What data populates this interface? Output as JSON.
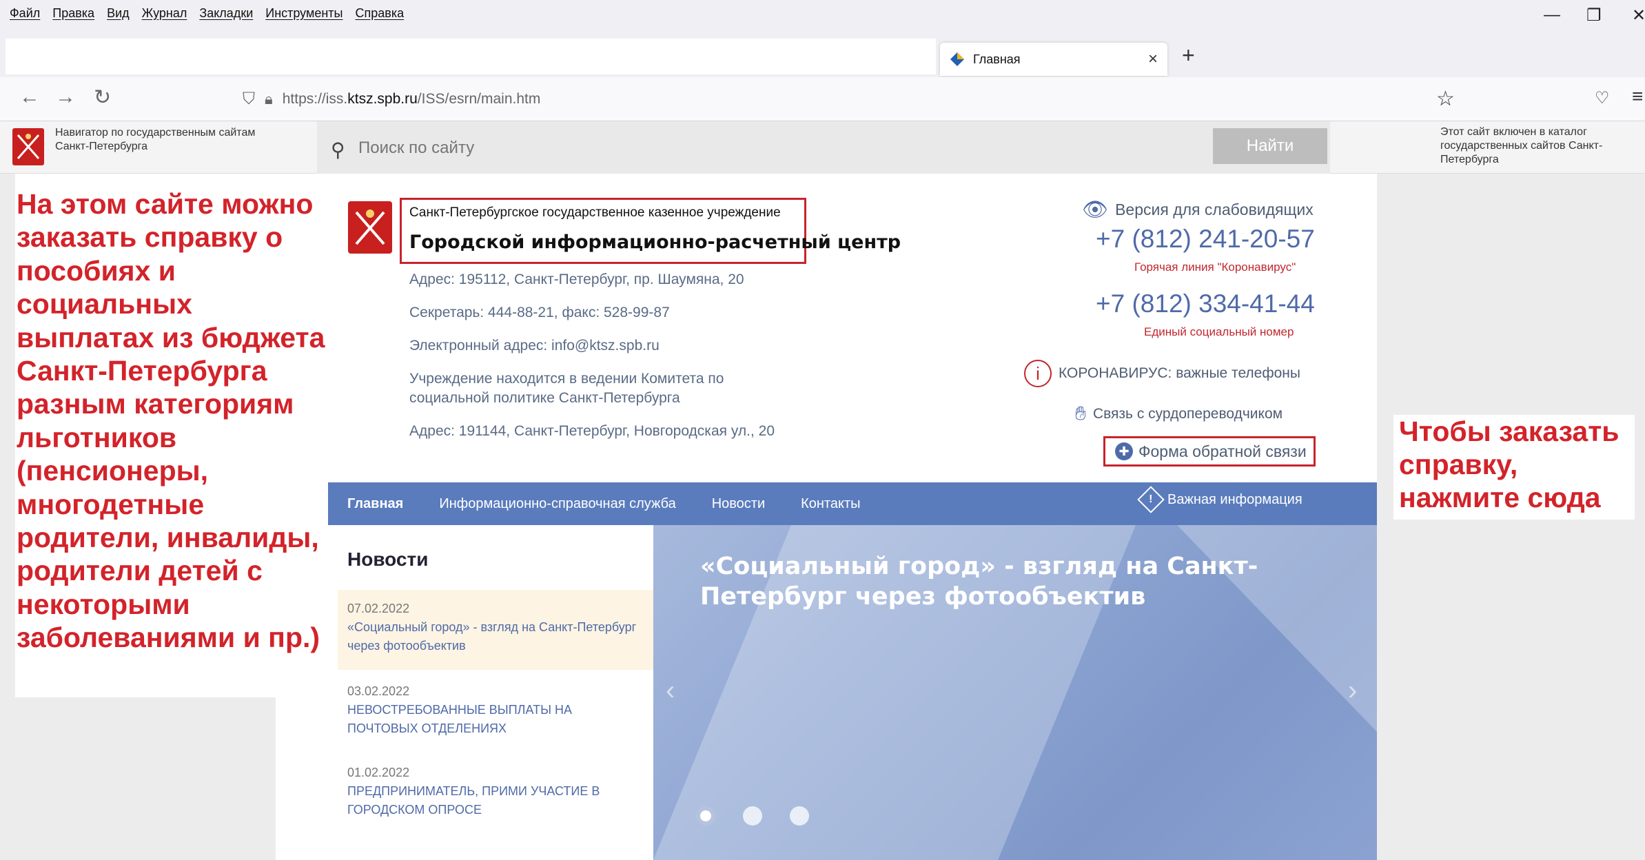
{
  "browser": {
    "menu": [
      "Файл",
      "Правка",
      "Вид",
      "Журнал",
      "Закладки",
      "Инструменты",
      "Справка"
    ],
    "tab_title": "Главная",
    "url_prefix": "https://iss.",
    "url_domain": "ktsz.spb.ru",
    "url_suffix": "/ISS/esrn/main.htm"
  },
  "gov_nav": {
    "left_text": "Навигатор по государственным сайтам Санкт-Петербурга",
    "search_placeholder": "Поиск по сайту",
    "search_button": "Найти",
    "right_text": "Этот сайт включен в каталог государственных сайтов Санкт-Петербурга"
  },
  "annotations": {
    "left": "На этом сайте можно заказать справку о пособиях и социальных выплатах из бюджета Санкт-Петербурга разным категориям льготников (пенсионеры, многодетные родители, инвалиды, родители детей с некоторыми заболеваниями и пр.)",
    "right": "Чтобы заказать справку, нажмите сюда"
  },
  "header": {
    "org_sub": "Санкт-Петербургское государственное казенное учреждение",
    "org_title": "Городской информационно-расчетный центр",
    "address1": "Адрес: 195112, Санкт-Петербург, пр. Шаумяна, 20",
    "secretary": "Секретарь: 444-88-21, факс: 528-99-87",
    "email": "Электронный адрес: info@ktsz.spb.ru",
    "ministry": "Учреждение находится в ведении Комитета по социальной политике Санкт-Петербурга",
    "address2": "Адрес: 191144, Санкт-Петербург, Новгородская ул., 20",
    "vision": "Версия для слабовидящих",
    "phone1": "+7 (812) 241-20-57",
    "phone1_note": "Горячая линия \"Коронавирус\"",
    "phone2": "+7 (812) 334-41-44",
    "phone2_note": "Единый социальный номер",
    "corona": "КОРОНАВИРУС: важные телефоны",
    "sign": "Связь с сурдопереводчиком",
    "feedback": "Форма обратной связи"
  },
  "nav": {
    "items": [
      "Главная",
      "Информационно-справочная служба",
      "Новости",
      "Контакты"
    ],
    "important": "Важная информация"
  },
  "news": {
    "heading": "Новости",
    "items": [
      {
        "date": "07.02.2022",
        "title": "«Социальный город» - взгляд на Санкт-Петербург через фотообъектив"
      },
      {
        "date": "03.02.2022",
        "title": "НЕВОСТРЕБОВАННЫЕ ВЫПЛАТЫ НА ПОЧТОВЫХ ОТДЕЛЕНИЯХ"
      },
      {
        "date": "01.02.2022",
        "title": "ПРЕДПРИНИМАТЕЛЬ, ПРИМИ УЧАСТИЕ В ГОРОДСКОМ ОПРОСЕ"
      }
    ]
  },
  "slider": {
    "title": "«Социальный город» - взгляд на Санкт-Петербург через фотообъектив"
  },
  "colors": {
    "accent": "#5a7cbd",
    "annotation": "#d3232a",
    "brand_red": "#c8201f"
  }
}
